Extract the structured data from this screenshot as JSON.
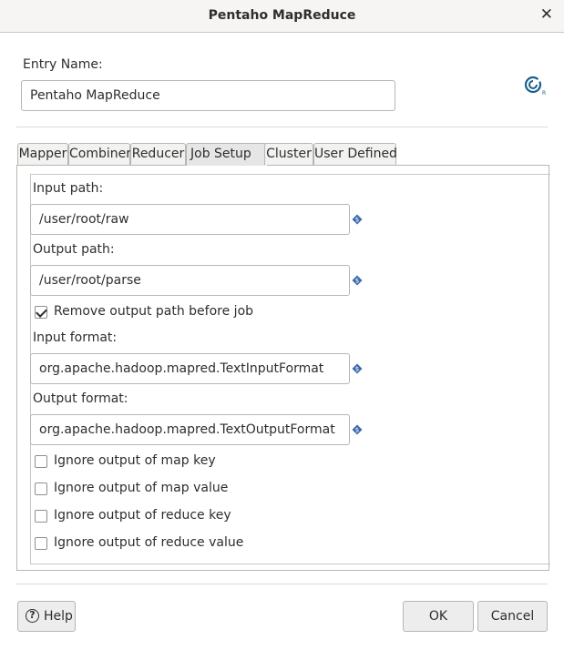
{
  "window": {
    "title": "Pentaho MapReduce"
  },
  "entry": {
    "label": "Entry Name:",
    "value": "Pentaho MapReduce"
  },
  "tabs": [
    {
      "label": "Mapper"
    },
    {
      "label": "Combiner"
    },
    {
      "label": "Reducer"
    },
    {
      "label": "Job Setup",
      "active": true
    },
    {
      "label": "Cluster"
    },
    {
      "label": "User Defined"
    }
  ],
  "job_setup": {
    "input_path": {
      "label": "Input path:",
      "value": "/user/root/raw"
    },
    "output_path": {
      "label": "Output path:",
      "value": "/user/root/parse"
    },
    "remove_output": {
      "label": "Remove output path before job",
      "checked": true
    },
    "input_format": {
      "label": "Input format:",
      "value": "org.apache.hadoop.mapred.TextInputFormat"
    },
    "output_format": {
      "label": "Output format:",
      "value": "org.apache.hadoop.mapred.TextOutputFormat"
    },
    "ignore_map_key": {
      "label": "Ignore output of map key",
      "checked": false
    },
    "ignore_map_value": {
      "label": "Ignore output of map value",
      "checked": false
    },
    "ignore_reduce_key": {
      "label": "Ignore output of reduce key",
      "checked": false
    },
    "ignore_reduce_value": {
      "label": "Ignore output of reduce value",
      "checked": false
    }
  },
  "buttons": {
    "help": "Help",
    "ok": "OK",
    "cancel": "Cancel"
  },
  "icons": {
    "close": "close-icon",
    "logo": "pentaho-logo-icon",
    "variable": "variable-diamond-icon",
    "help": "help-icon"
  },
  "colors": {
    "variable_icon": "#3b6aa8",
    "logo": "#1a5f8f"
  }
}
